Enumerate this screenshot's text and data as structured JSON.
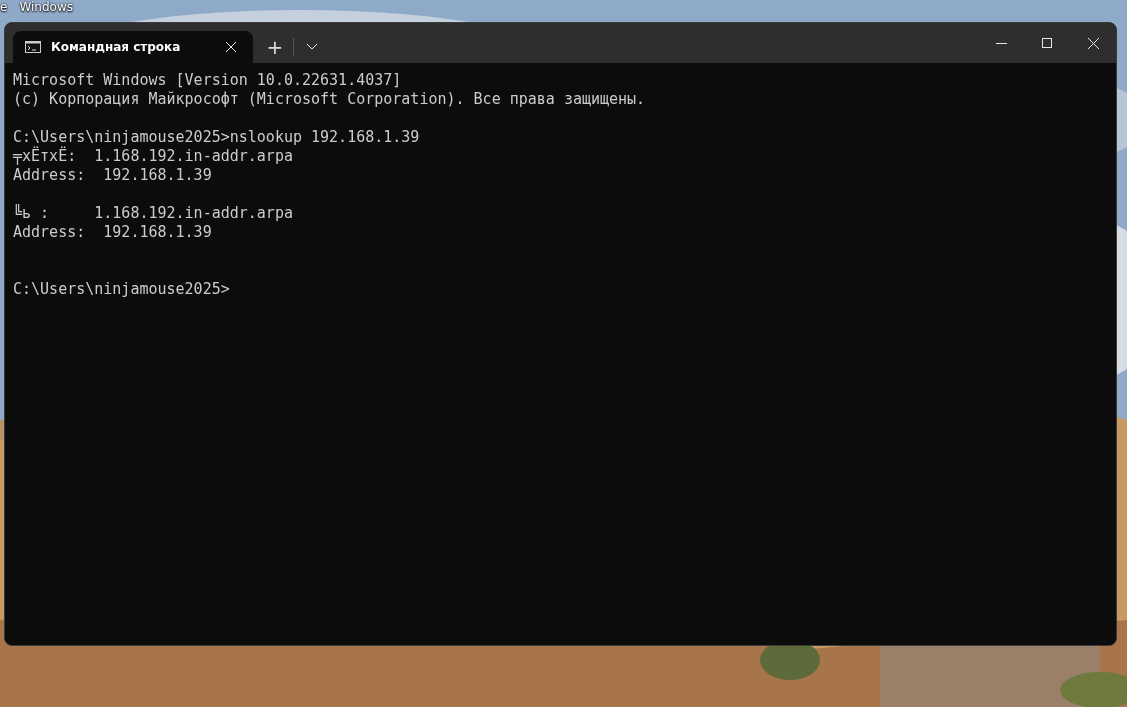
{
  "desktop": {
    "icon_labels": [
      "e",
      "Windows"
    ]
  },
  "window": {
    "tabs": [
      {
        "title": "Командная строка",
        "selected": true
      }
    ],
    "new_tab": "+"
  },
  "terminal": {
    "lines": [
      {
        "kind": "text",
        "text": "Microsoft Windows [Version 10.0.22631.4037]"
      },
      {
        "kind": "text",
        "text": "(c) Корпорация Майкрософт (Microsoft Corporation). Все права защищены."
      },
      {
        "kind": "blank"
      },
      {
        "kind": "text",
        "text": "C:\\Users\\ninjamouse2025>nslookup 192.168.1.39"
      },
      {
        "kind": "text",
        "text": "╤xЁтxЁ:  1.168.192.in-addr.arpa"
      },
      {
        "kind": "text",
        "text": "Address:  192.168.1.39"
      },
      {
        "kind": "blank"
      },
      {
        "kind": "text",
        "text": "╚ь :     1.168.192.in-addr.arpa"
      },
      {
        "kind": "text",
        "text": "Address:  192.168.1.39"
      },
      {
        "kind": "blank"
      },
      {
        "kind": "blank"
      },
      {
        "kind": "text",
        "text": "C:\\Users\\ninjamouse2025>"
      }
    ]
  }
}
